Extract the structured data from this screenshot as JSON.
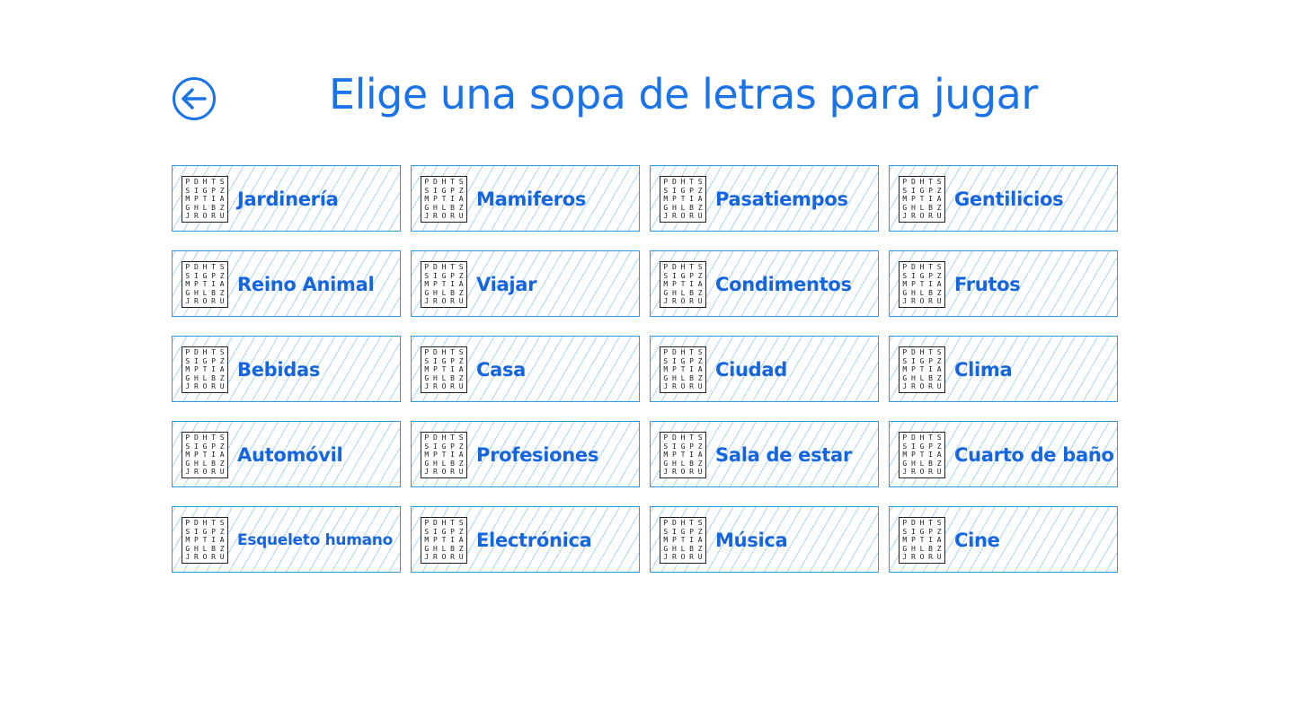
{
  "header": {
    "title": "Elige una sopa de letras para jugar",
    "back_icon": "arrow-left-circle-icon"
  },
  "colors": {
    "accent": "#1a73e8",
    "tile_border": "#2b9be6",
    "stripe": "#a9d5f3"
  },
  "puzzle_icon_letters": [
    [
      "P",
      "D",
      "H",
      "T",
      "S"
    ],
    [
      "S",
      "I",
      "G",
      "P",
      "Z"
    ],
    [
      "M",
      "P",
      "T",
      "I",
      "A"
    ],
    [
      "G",
      "H",
      "L",
      "B",
      "Z"
    ],
    [
      "J",
      "R",
      "O",
      "R",
      "U"
    ]
  ],
  "categories": [
    {
      "label": "Jardinería"
    },
    {
      "label": "Mamiferos"
    },
    {
      "label": "Pasatiempos"
    },
    {
      "label": "Gentilicios"
    },
    {
      "label": "Reino Animal"
    },
    {
      "label": "Viajar"
    },
    {
      "label": "Condimentos"
    },
    {
      "label": "Frutos"
    },
    {
      "label": "Bebidas"
    },
    {
      "label": "Casa"
    },
    {
      "label": "Ciudad"
    },
    {
      "label": "Clima"
    },
    {
      "label": "Automóvil"
    },
    {
      "label": "Profesiones"
    },
    {
      "label": "Sala de estar"
    },
    {
      "label": "Cuarto de baño"
    },
    {
      "label": "Esqueleto humano"
    },
    {
      "label": "Electrónica"
    },
    {
      "label": "Música"
    },
    {
      "label": "Cine"
    }
  ]
}
